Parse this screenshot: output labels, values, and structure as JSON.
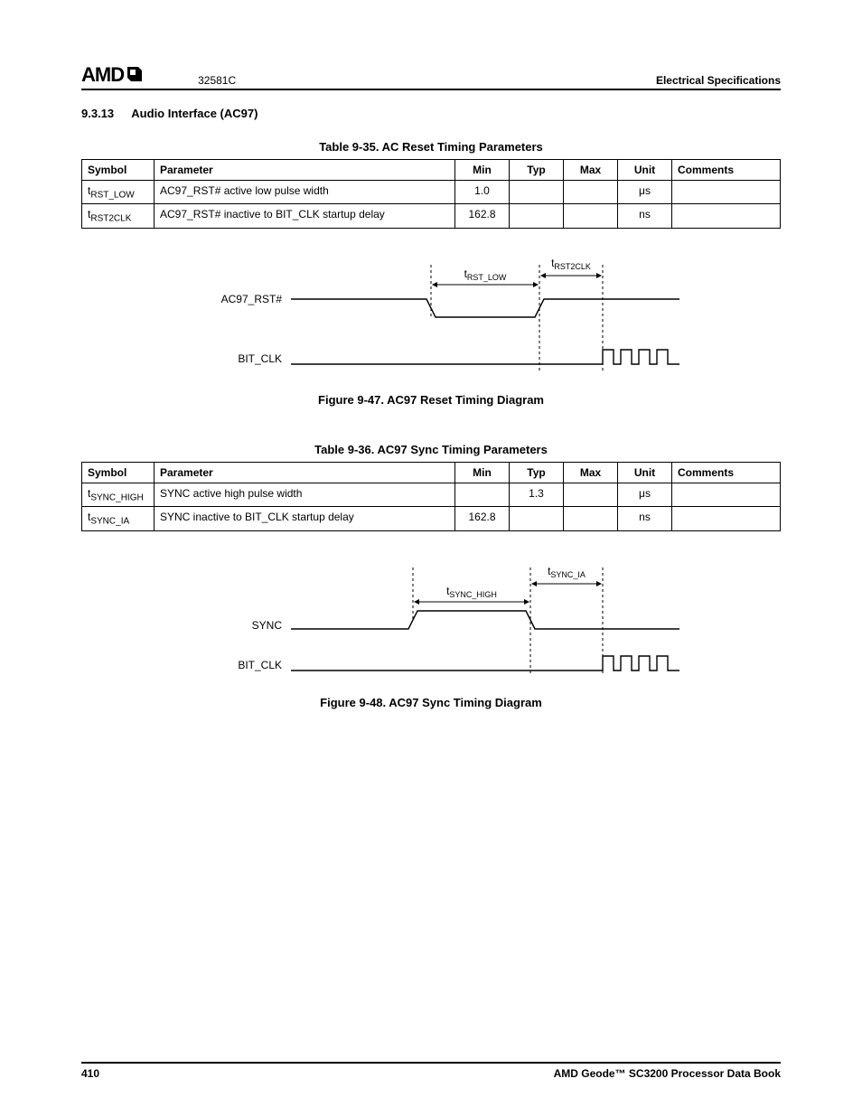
{
  "header": {
    "logo_text": "AMD",
    "doc_number": "32581C",
    "right": "Electrical Specifications"
  },
  "section": {
    "number": "9.3.13",
    "title": "Audio Interface (AC97)"
  },
  "table1": {
    "caption": "Table 9-35.  AC Reset Timing Parameters",
    "headers": [
      "Symbol",
      "Parameter",
      "Min",
      "Typ",
      "Max",
      "Unit",
      "Comments"
    ],
    "rows": [
      {
        "sym_pre": "t",
        "sym_sub": "RST_LOW",
        "param": "AC97_RST# active low pulse width",
        "min": "1.0",
        "typ": "",
        "max": "",
        "unit": "μs",
        "comments": ""
      },
      {
        "sym_pre": "t",
        "sym_sub": "RST2CLK",
        "param": "AC97_RST# inactive to BIT_CLK startup delay",
        "min": "162.8",
        "typ": "",
        "max": "",
        "unit": "ns",
        "comments": ""
      }
    ]
  },
  "figure1": {
    "caption": "Figure 9-47.  AC97 Reset Timing Diagram",
    "signal1": "AC97_RST#",
    "signal2": "BIT_CLK",
    "label_pre1": "t",
    "label_sub1": "RST_LOW",
    "label_pre2": "t",
    "label_sub2": "RST2CLK"
  },
  "table2": {
    "caption": "Table 9-36.  AC97 Sync Timing Parameters",
    "headers": [
      "Symbol",
      "Parameter",
      "Min",
      "Typ",
      "Max",
      "Unit",
      "Comments"
    ],
    "rows": [
      {
        "sym_pre": "t",
        "sym_sub": "SYNC_HIGH",
        "param": "SYNC active high pulse width",
        "min": "",
        "typ": "1.3",
        "max": "",
        "unit": "μs",
        "comments": ""
      },
      {
        "sym_pre": "t",
        "sym_sub": "SYNC_IA",
        "param": "SYNC inactive to BIT_CLK startup delay",
        "min": "162.8",
        "typ": "",
        "max": "",
        "unit": "ns",
        "comments": ""
      }
    ]
  },
  "figure2": {
    "caption": "Figure 9-48.  AC97 Sync Timing Diagram",
    "signal1": "SYNC",
    "signal2": "BIT_CLK",
    "label_pre1": "t",
    "label_sub1": "SYNC_HIGH",
    "label_pre2": "t",
    "label_sub2": "SYNC_IA"
  },
  "footer": {
    "page": "410",
    "book": "AMD Geode™ SC3200 Processor Data Book"
  }
}
